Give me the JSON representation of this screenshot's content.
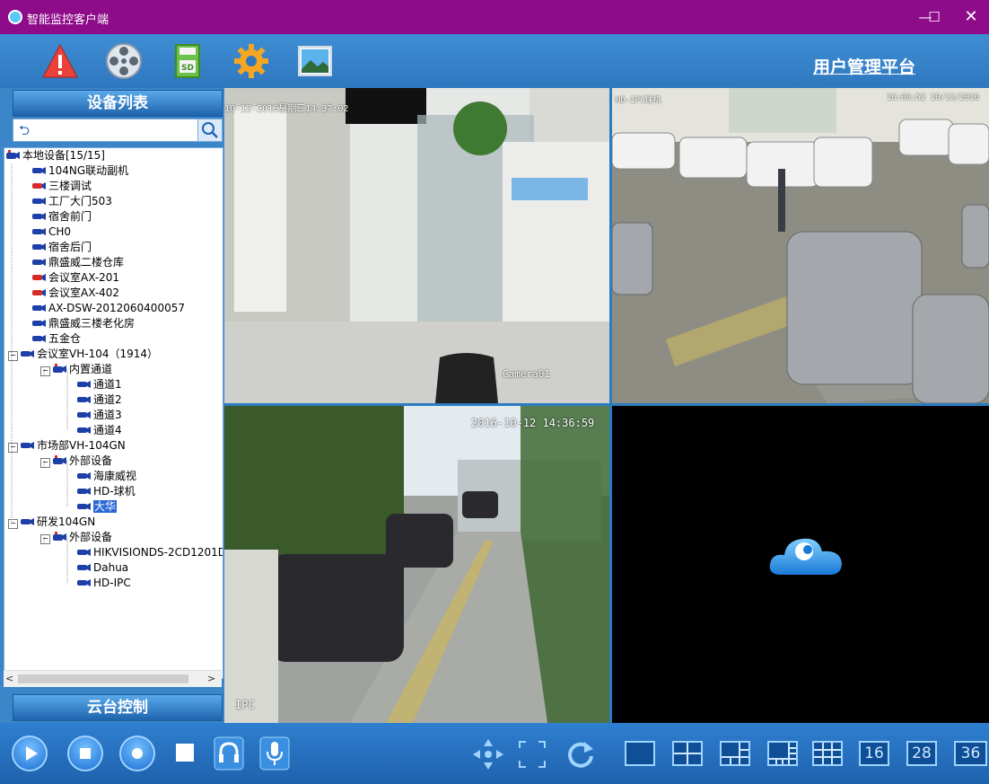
{
  "window": {
    "title": "智能监控客户端",
    "minimize_glyph": "—",
    "maximize_glyph": "☐",
    "close_glyph": "✕"
  },
  "toolbar": {
    "icons": [
      "alarm-icon",
      "film-reel-icon",
      "sd-card-icon",
      "settings-gear-icon",
      "picture-icon"
    ],
    "sd_label": "SD",
    "platform_title": "用户管理平台"
  },
  "sidebar": {
    "device_list_title": "设备列表",
    "search": {
      "value": "",
      "placeholder": ""
    },
    "ptz_title": "云台控制",
    "tree": {
      "root": "本地设备[15/15]",
      "devices": [
        "104NG联动副机",
        "三楼调试",
        "工厂大门503",
        "宿舍前门",
        "CH0",
        "宿舍后门",
        "鼎盛威二楼仓库",
        "会议室AX-201",
        "会议室AX-402",
        "AX-DSW-2012060400057",
        "鼎盛威三楼老化房",
        "五金仓",
        "会议室VH-104（1914）",
        "市场部VH-104GN",
        "研发104GN"
      ],
      "vh104_group": "内置通道",
      "vh104_channels": [
        "通道1",
        "通道2",
        "通道3",
        "通道4"
      ],
      "market_group": "外部设备",
      "market_children": [
        "海康威视",
        "HD-球机",
        "大华"
      ],
      "rd_group": "外部设备",
      "rd_children": [
        "HIKVISIONDS-2CD1201D",
        "Dahua",
        "HD-IPC"
      ],
      "selected": "大华"
    }
  },
  "videos": {
    "v1_osd_time": "10-12-2016星期三14:37:02",
    "v1_osd_name": "Camera01",
    "v2_osd_name": "HD-IPC球机",
    "v2_osd_time": "16:06:52 10/12/2016",
    "v3_osd_time": "2016-10-12 14:36:59",
    "v3_osd_name": "IPC"
  },
  "controls": {
    "left_buttons": [
      "play-icon",
      "stop-icon",
      "record-icon",
      "snapshot-icon",
      "headphone-icon",
      "microphone-icon"
    ],
    "layouts": [
      "1",
      "4",
      "6",
      "8",
      "9",
      "16",
      "28",
      "36"
    ]
  },
  "colors": {
    "titlebar": "#8e0b8a",
    "toolbar": "#3f8ed3",
    "selection": "#2b68d6"
  }
}
